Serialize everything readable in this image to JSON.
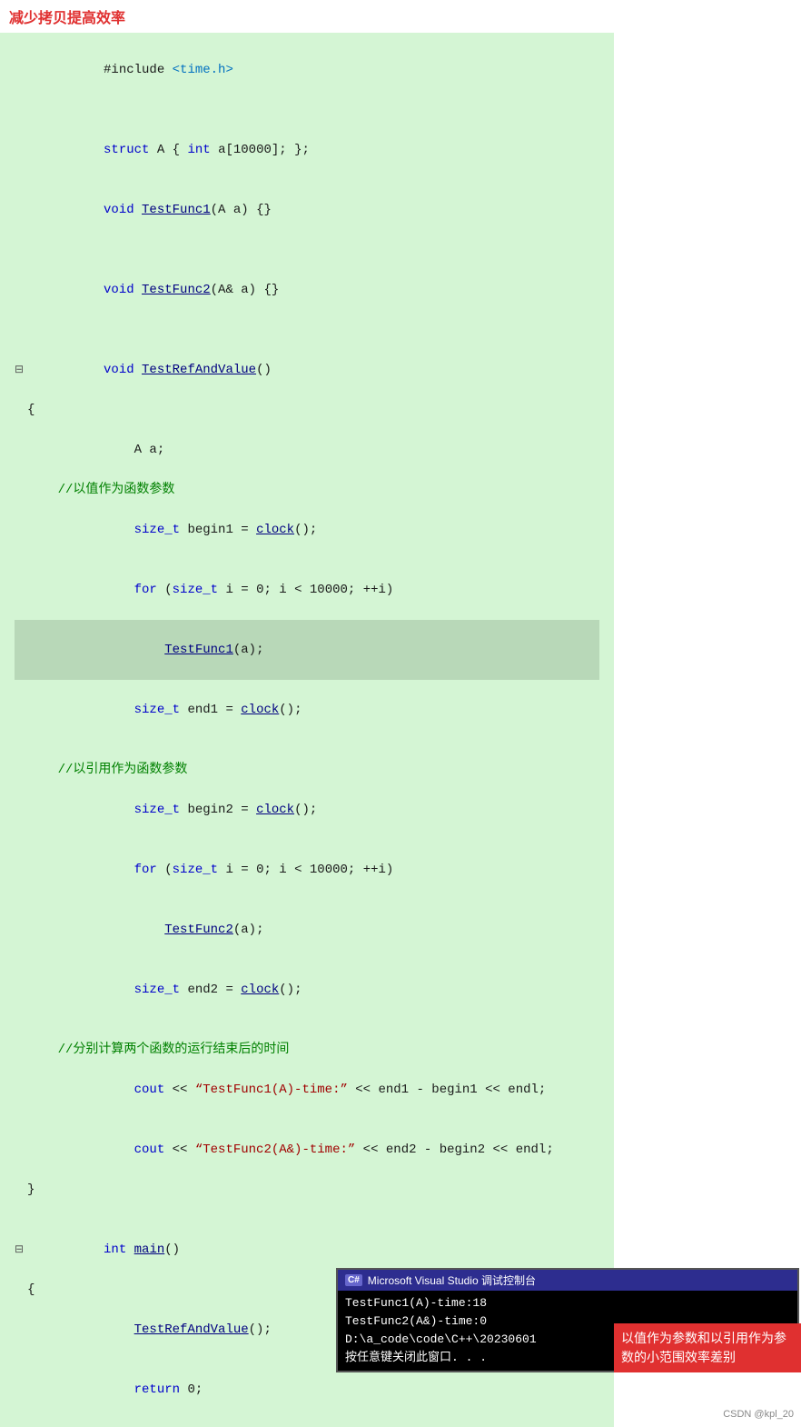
{
  "title": "减少拷贝提高效率",
  "code_lines": [
    {
      "id": 1,
      "marker": "",
      "content": "#include <time.h>",
      "type": "include",
      "highlighted": false
    },
    {
      "id": 2,
      "marker": "",
      "content": "",
      "type": "blank",
      "highlighted": false
    },
    {
      "id": 3,
      "marker": "",
      "content": "struct A { int a[10000]; };",
      "type": "code",
      "highlighted": false
    },
    {
      "id": 4,
      "marker": "",
      "content": "void TestFunc1(A a) {}",
      "type": "code",
      "highlighted": false
    },
    {
      "id": 5,
      "marker": "",
      "content": "",
      "type": "blank",
      "highlighted": false
    },
    {
      "id": 6,
      "marker": "",
      "content": "void TestFunc2(A& a) {}",
      "type": "code",
      "highlighted": false
    },
    {
      "id": 7,
      "marker": "",
      "content": "",
      "type": "blank",
      "highlighted": false
    },
    {
      "id": 8,
      "marker": "⊟",
      "content": "void TestRefAndValue()",
      "type": "code",
      "highlighted": false
    },
    {
      "id": 9,
      "marker": "",
      "content": "{",
      "type": "code",
      "highlighted": false
    },
    {
      "id": 10,
      "marker": "",
      "content": "    A a;",
      "type": "code",
      "highlighted": false
    },
    {
      "id": 11,
      "marker": "",
      "content": "    //以值作为函数参数",
      "type": "comment",
      "highlighted": false
    },
    {
      "id": 12,
      "marker": "",
      "content": "    size_t begin1 = clock();",
      "type": "code",
      "highlighted": false
    },
    {
      "id": 13,
      "marker": "",
      "content": "    for (size_t i = 0; i < 10000; ++i)",
      "type": "code",
      "highlighted": false
    },
    {
      "id": 14,
      "marker": "",
      "content": "        TestFunc1(a);",
      "type": "code",
      "highlighted": true
    },
    {
      "id": 15,
      "marker": "",
      "content": "    size_t end1 = clock();",
      "type": "code",
      "highlighted": false
    },
    {
      "id": 16,
      "marker": "",
      "content": "",
      "type": "blank",
      "highlighted": false
    },
    {
      "id": 17,
      "marker": "",
      "content": "    //以引用作为函数参数",
      "type": "comment",
      "highlighted": false
    },
    {
      "id": 18,
      "marker": "",
      "content": "    size_t begin2 = clock();",
      "type": "code",
      "highlighted": false
    },
    {
      "id": 19,
      "marker": "",
      "content": "    for (size_t i = 0; i < 10000; ++i)",
      "type": "code",
      "highlighted": false
    },
    {
      "id": 20,
      "marker": "",
      "content": "        TestFunc2(a);",
      "type": "code",
      "highlighted": false
    },
    {
      "id": 21,
      "marker": "",
      "content": "    size_t end2 = clock();",
      "type": "code",
      "highlighted": false
    },
    {
      "id": 22,
      "marker": "",
      "content": "",
      "type": "blank",
      "highlighted": false
    },
    {
      "id": 23,
      "marker": "",
      "content": "    //分别计算两个函数的运行结束后的时间",
      "type": "comment",
      "highlighted": false
    },
    {
      "id": 24,
      "marker": "",
      "content": "    cout << \"TestFunc1(A)-time:\" << end1 - begin1 << endl;",
      "type": "code",
      "highlighted": false
    },
    {
      "id": 25,
      "marker": "",
      "content": "    cout << \"TestFunc2(A&)-time:\" << end2 - begin2 << endl;",
      "type": "code",
      "highlighted": false
    },
    {
      "id": 26,
      "marker": "",
      "content": "}",
      "type": "code",
      "highlighted": false
    }
  ],
  "main_lines": [
    {
      "id": 1,
      "marker": "⊟",
      "content": "int main()"
    },
    {
      "id": 2,
      "marker": "",
      "content": "{"
    },
    {
      "id": 3,
      "marker": "",
      "content": "    TestRefAndValue();"
    },
    {
      "id": 4,
      "marker": "",
      "content": "    return 0;"
    },
    {
      "id": 5,
      "marker": "",
      "content": "}"
    }
  ],
  "console": {
    "title": "Microsoft Visual Studio 调试控制台",
    "lines": [
      "TestFunc1(A)-time:18",
      "TestFunc2(A&)-time:0"
    ],
    "path_line": "D:\\a_code\\code\\C++\\20230601",
    "press_line": "按任意键关闭此窗口. . ."
  },
  "annotation": "以值作为参数和以引用作为参数的小范围效率差别",
  "csdn_watermark": "CSDN @kpl_20"
}
